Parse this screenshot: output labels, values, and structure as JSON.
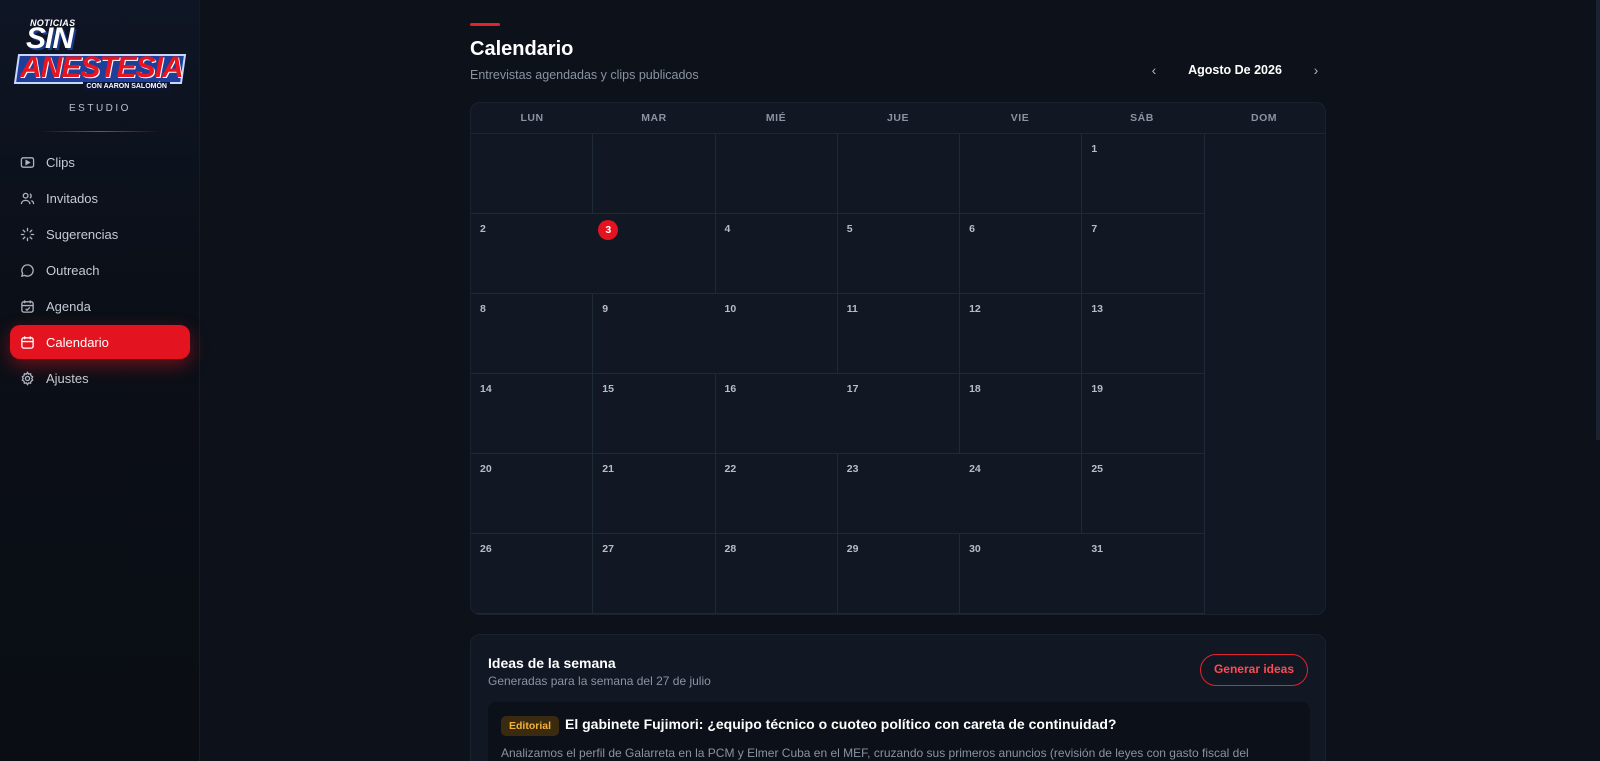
{
  "brand": {
    "logo_small": "NOTICIAS",
    "logo_main": "SIN",
    "logo_sub": "ANESTESIA",
    "logo_con": "CON AARON SALOMÓN",
    "studio": "ESTUDIO"
  },
  "sidebar": {
    "items": [
      {
        "label": "Clips",
        "icon": "play-icon"
      },
      {
        "label": "Invitados",
        "icon": "users-icon"
      },
      {
        "label": "Sugerencias",
        "icon": "loader-icon"
      },
      {
        "label": "Outreach",
        "icon": "chat-icon"
      },
      {
        "label": "Agenda",
        "icon": "calendar-check-icon"
      },
      {
        "label": "Calendario",
        "icon": "calendar-icon",
        "active": true
      },
      {
        "label": "Ajustes",
        "icon": "gear-icon"
      }
    ]
  },
  "header": {
    "title": "Calendario",
    "subtitle": "Entrevistas agendadas y clips publicados",
    "month": "Agosto De 2026",
    "prev": "‹",
    "next": "›"
  },
  "calendar": {
    "weekdays": [
      "LUN",
      "MAR",
      "MIÉ",
      "JUE",
      "VIE",
      "SÁB",
      "DOM"
    ],
    "leading_empty": 5,
    "days": [
      "1",
      "2",
      "3",
      "4",
      "5",
      "6",
      "7",
      "8",
      "9",
      "10",
      "11",
      "12",
      "13",
      "14",
      "15",
      "16",
      "17",
      "18",
      "19",
      "20",
      "21",
      "22",
      "23",
      "24",
      "25",
      "26",
      "27",
      "28",
      "29",
      "30",
      "31"
    ],
    "today": "3",
    "trailing_empty": 6
  },
  "ideas": {
    "title": "Ideas de la semana",
    "subtitle": "Generadas para la semana del 27 de julio",
    "button": "Generar ideas",
    "card": {
      "badge": "Editorial",
      "title": "El gabinete Fujimori: ¿equipo técnico o cuoteo político con careta de continuidad?",
      "description": "Analizamos el perfil de Galarreta en la PCM y Elmer Cuba en el MEF, cruzando sus primeros anuncios (revisión de leyes con gasto fiscal del"
    }
  },
  "colors": {
    "accent": "#e3141f",
    "background": "#0c111a",
    "panel": "#111824",
    "badge_text": "#f3b23a"
  }
}
